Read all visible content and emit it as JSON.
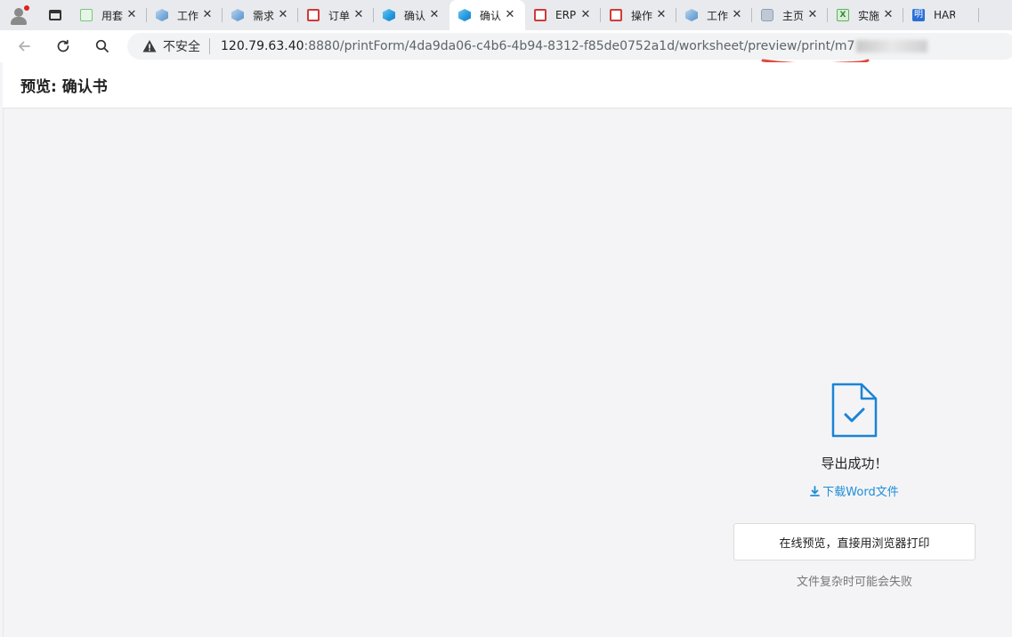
{
  "tabs": [
    {
      "title": "用套",
      "icon": "book-icon"
    },
    {
      "title": "工作",
      "icon": "cube-icon"
    },
    {
      "title": "需求",
      "icon": "cube-icon"
    },
    {
      "title": "订单",
      "icon": "red-doc-icon"
    },
    {
      "title": "确认",
      "icon": "cube-icon-bright"
    },
    {
      "title": "确认",
      "icon": "cube-icon-bright",
      "active": true
    },
    {
      "title": "ERP",
      "icon": "red-doc-icon"
    },
    {
      "title": "操作",
      "icon": "red-doc-icon"
    },
    {
      "title": "工作",
      "icon": "cube-icon"
    },
    {
      "title": "主页",
      "icon": "home-icon"
    },
    {
      "title": "实施",
      "icon": "excel-icon"
    },
    {
      "title": "HAR",
      "icon": "ming-icon"
    }
  ],
  "tab_close_glyph": "✕",
  "excel_glyph": "X",
  "ming_glyph": "明",
  "toolbar": {
    "security_label": "不安全",
    "url_host": "120.79.63.40",
    "url_rest": ":8880/printForm/4da9da06-c4b6-4b94-8312-f85de0752a1d/worksheet/preview/print/m7"
  },
  "page": {
    "title": "预览: 确认书"
  },
  "result": {
    "status": "导出成功！",
    "download_link": "下载Word文件",
    "print_button": "在线预览，直接用浏览器打印",
    "note": "文件复杂时可能会失败"
  },
  "colors": {
    "accent": "#1f8dd6",
    "icon_blue": "#1a84d6",
    "annotation_red": "#e0493f"
  }
}
